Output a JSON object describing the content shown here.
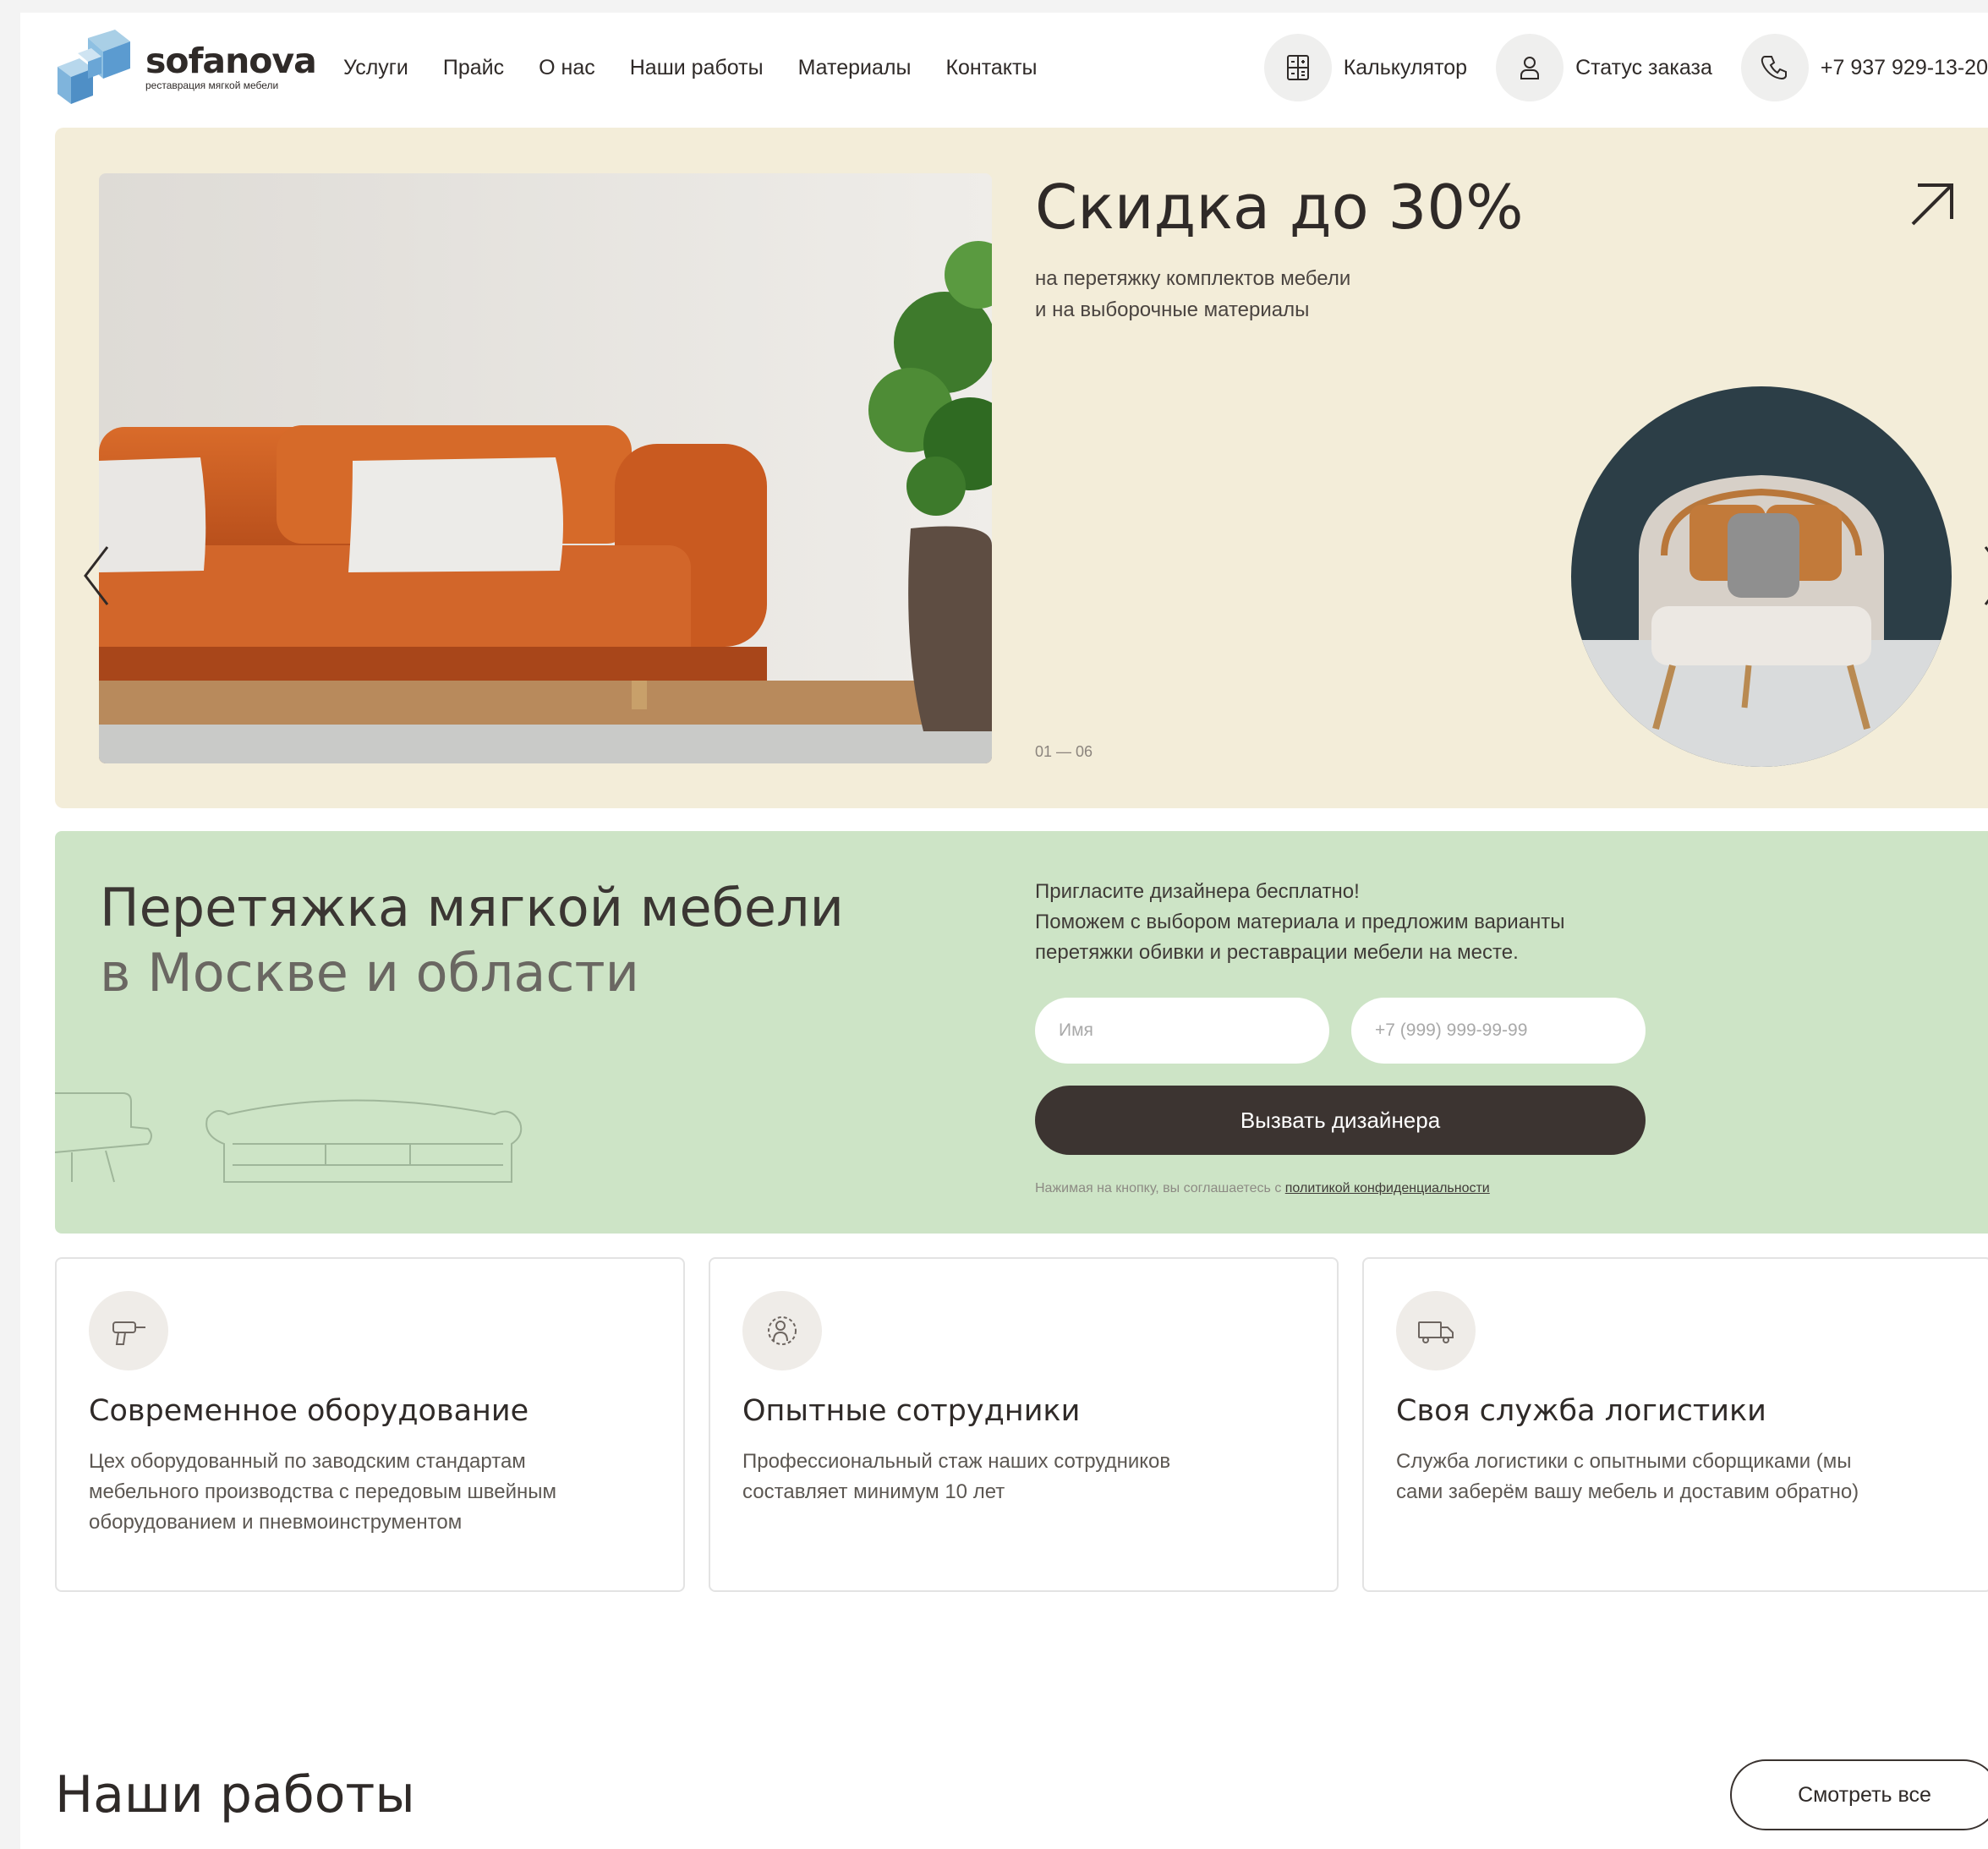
{
  "header": {
    "logo": {
      "name": "sofanova",
      "tagline": "реставрация мягкой мебели"
    },
    "nav": [
      "Услуги",
      "Прайс",
      "О нас",
      "Наши работы",
      "Материалы",
      "Контакты"
    ],
    "actions": {
      "calculator": "Калькулятор",
      "order_status": "Статус заказа",
      "phone": "+7 937 929-13-20"
    }
  },
  "hero": {
    "title": "Скидка до 30%",
    "subtitle_lines": [
      "на перетяжку комплектов мебели",
      "и на выборочные материалы"
    ],
    "counter": "01 — 06"
  },
  "lead": {
    "title_line1": "Перетяжка мягкой мебели",
    "title_line2": "в Москве и области",
    "text_lines": [
      "Пригласите дизайнера бесплатно!",
      "Поможем с выбором материала и предложим варианты",
      "перетяжки обивки и реставрации мебели на месте."
    ],
    "name_placeholder": "Имя",
    "phone_placeholder": "+7 (999) 999-99-99",
    "button": "Вызвать дизайнера",
    "disclaimer_text": "Нажимая на кнопку, вы соглашаетесь с ",
    "disclaimer_link": "политикой конфиденциальности"
  },
  "features": [
    {
      "icon": "drill-icon",
      "title": "Современное оборудование",
      "desc_lines": [
        "Цех оборудованный по заводским стандартам",
        "мебельного производства с передовым швейным",
        "оборудованием и пневмоинструментом"
      ]
    },
    {
      "icon": "worker-gear-icon",
      "title": "Опытные сотрудники",
      "desc_lines": [
        "Профессиональный стаж наших сотрудников",
        "составляет минимум 10 лет"
      ]
    },
    {
      "icon": "truck-icon",
      "title": "Своя служба логистики",
      "desc_lines": [
        "Служба логистики с опытными сборщиками (мы",
        "сами заберём вашу мебель и доставим обратно)"
      ]
    }
  ],
  "works": {
    "title": "Наши работы",
    "see_all": "Смотреть все"
  },
  "colors": {
    "hero_bg": "#f3edd9",
    "lead_bg": "#cde4c6",
    "button_dark": "#3c3431",
    "text": "#2f2a28"
  }
}
